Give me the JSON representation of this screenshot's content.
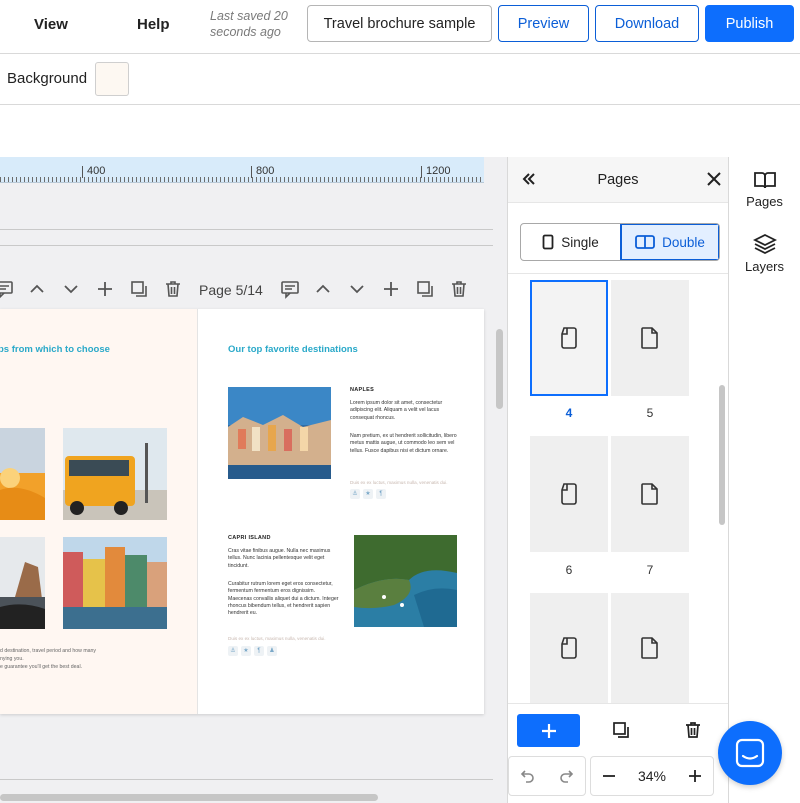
{
  "menu": {
    "view": "View",
    "help": "Help"
  },
  "status": {
    "saved": "Last saved 20 seconds ago"
  },
  "toolbar": {
    "doc_title": "Travel brochure sample",
    "preview": "Preview",
    "download": "Download",
    "publish": "Publish"
  },
  "background": {
    "label": "Background",
    "color": "#fdf8f2"
  },
  "ruler": {
    "marks": [
      "400",
      "800",
      "1200"
    ]
  },
  "page_tools": {
    "page_indicator": "Page 5/14"
  },
  "spread": {
    "left_heading": "ps from which to choose",
    "right_heading": "Our top favorite destinations",
    "left_footer": [
      "d destination, travel period and how many",
      "nying you.",
      "e guarantee you'll get the best deal."
    ],
    "naples": {
      "title": "NAPLES",
      "para1": "Lorem ipsum dolor sit amet, consectetur adipiscing elit. Aliquam a velit vel lacus consequat rhoncus.",
      "para2": "Nam pretium, ex ut hendrerit sollicitudin, libero metus mattis augue, ut commodo leo sem vel tellus. Fusce dapibus nisi et dictum ornare.",
      "faint": "Duis ex ex luctus, maximus nulla, venenatis dui."
    },
    "capri": {
      "title": "CAPRI ISLAND",
      "para1": "Cras vitae finibus augue. Nulla nec maximus tellus. Nunc lacinia pellentesque velit eget tincidunt.",
      "para2": "Curabitur rutrum lorem eget eros consectetur, fermentum fermentum eros dignissim. Maecenas convallis aliquet dui a dictum. Integer rhoncus bibendum tellus, et hendrerit sapien hendrerit eu.",
      "faint": "Duis ex ex luctus, maximus nulla, venenatis dui."
    }
  },
  "pages_panel": {
    "title": "Pages",
    "view_single": "Single",
    "view_double": "Double",
    "thumbnails": [
      "4",
      "5",
      "6",
      "7"
    ],
    "selected_page": "4",
    "zoom": "34%"
  },
  "rail": {
    "pages": "Pages",
    "layers": "Layers"
  },
  "colors": {
    "accent": "#0d6efd",
    "heading": "#2aa9c9",
    "ruler": "#d8ebfa"
  }
}
